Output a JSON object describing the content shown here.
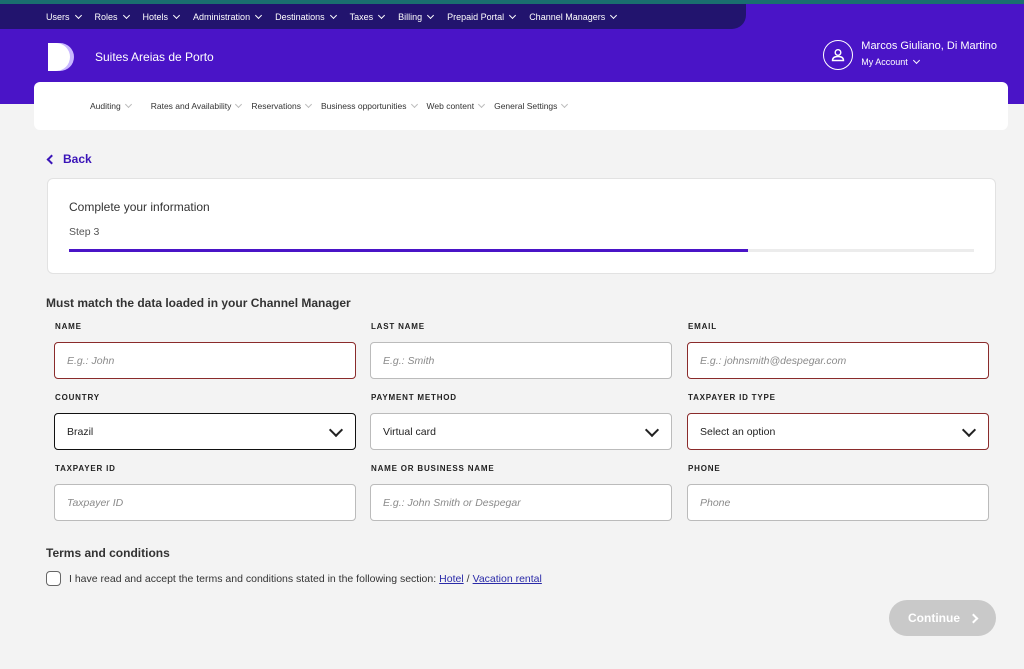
{
  "top_nav": {
    "items": [
      "Users",
      "Roles",
      "Hotels",
      "Administration",
      "Destinations",
      "Taxes",
      "Billing",
      "Prepaid Portal",
      "Channel Managers"
    ]
  },
  "header": {
    "hotel_name": "Suites Areias de Porto",
    "account_name": "Marcos Giuliano, Di Martino",
    "account_link": "My Account"
  },
  "sub_nav": {
    "items": [
      "Auditing",
      "Rates and Availability",
      "Reservations",
      "Business opportunities",
      "Web content",
      "General Settings"
    ]
  },
  "back_label": "Back",
  "step_card": {
    "title": "Complete your information",
    "step": "Step 3",
    "progress": 0.75
  },
  "form": {
    "section_title": "Must match the data loaded in your Channel Manager",
    "name": {
      "label": "NAME",
      "placeholder": "E.g.: John"
    },
    "last_name": {
      "label": "LAST NAME",
      "placeholder": "E.g.: Smith"
    },
    "email": {
      "label": "EMAIL",
      "placeholder": "E.g.: johnsmith@despegar.com"
    },
    "country": {
      "label": "COUNTRY",
      "value": "Brazil"
    },
    "payment_method": {
      "label": "PAYMENT METHOD",
      "value": "Virtual card"
    },
    "taxpayer_id_type": {
      "label": "TAXPAYER ID TYPE",
      "value": "Select an option"
    },
    "taxpayer_id": {
      "label": "TAXPAYER ID",
      "placeholder": "Taxpayer ID"
    },
    "business_name": {
      "label": "NAME OR BUSINESS NAME",
      "placeholder": "E.g.: John Smith or Despegar"
    },
    "phone": {
      "label": "PHONE",
      "placeholder": "Phone"
    }
  },
  "terms": {
    "title": "Terms and conditions",
    "text": "I have read and accept the terms and conditions stated in the following section:",
    "link_hotel": "Hotel",
    "separator": "/",
    "link_vacation": "Vacation rental"
  },
  "continue_label": "Continue",
  "colors": {
    "brand": "#4a14c7",
    "nav_dark": "#22146e",
    "error_border": "#8a2b2b",
    "disabled": "#c9c9c9"
  }
}
